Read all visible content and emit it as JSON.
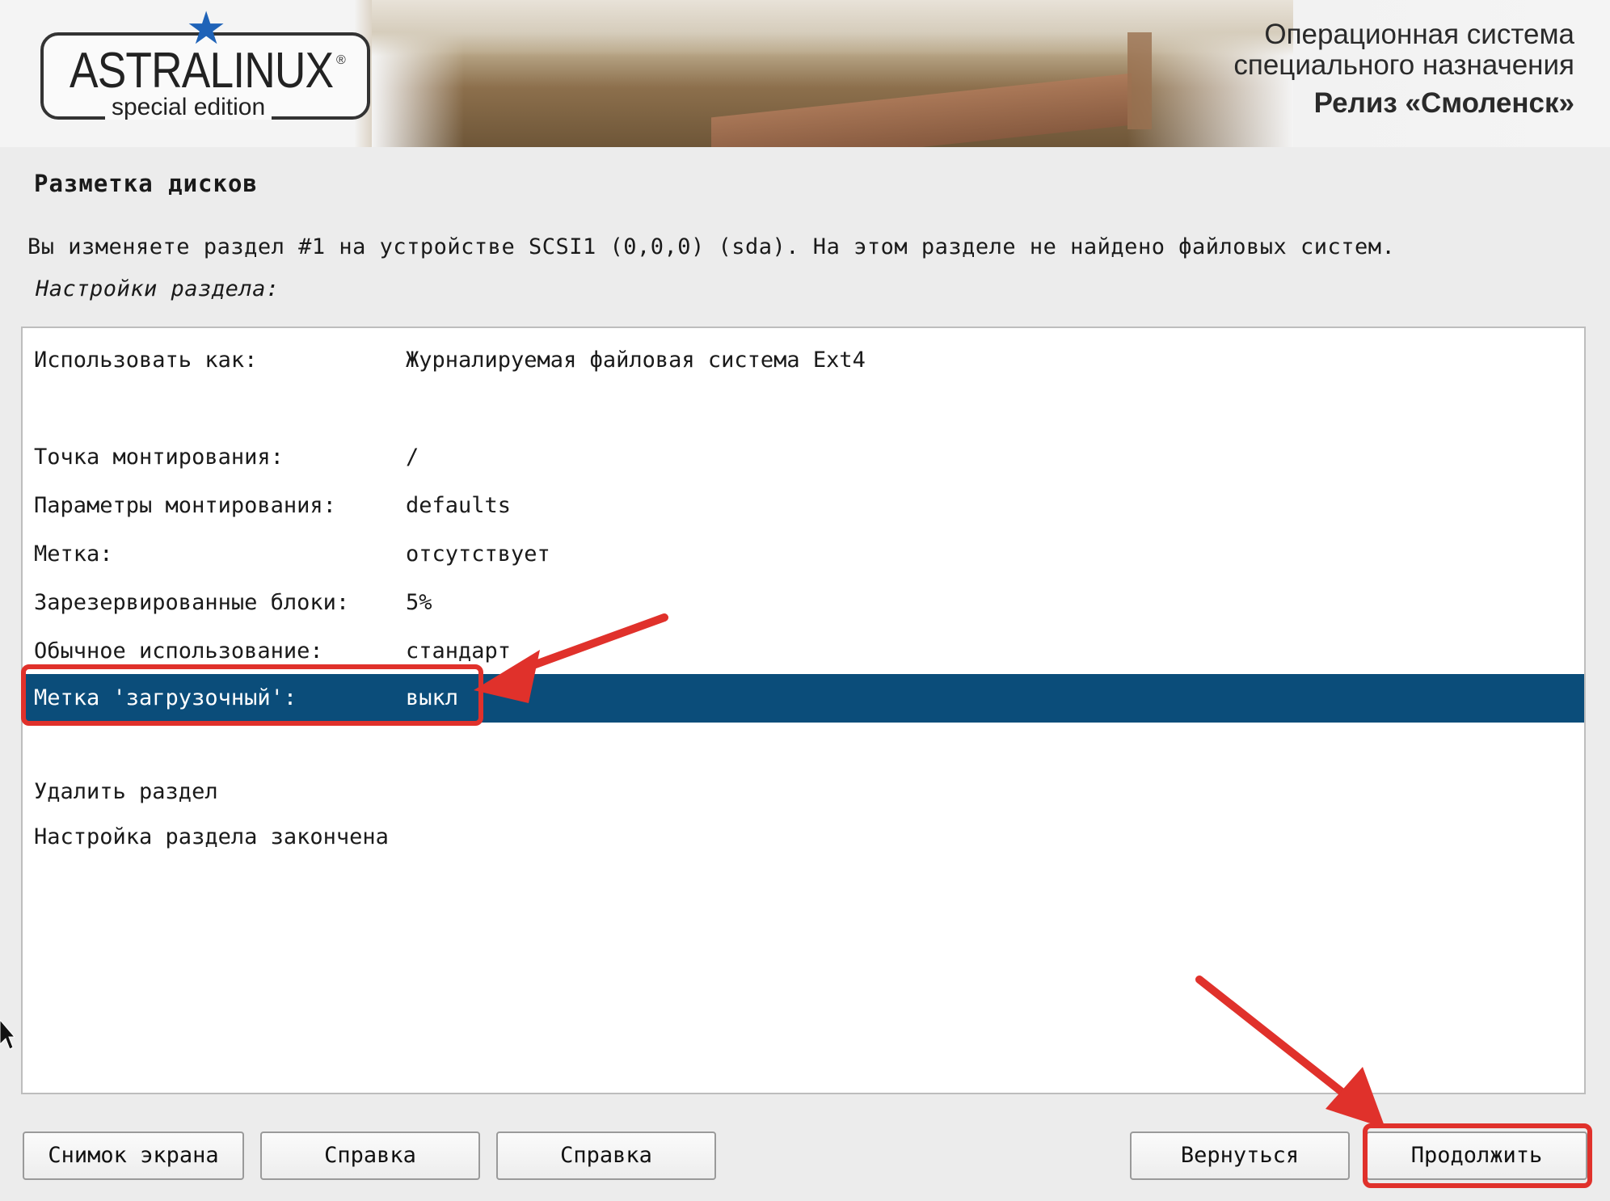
{
  "banner": {
    "logo_text": "ASTRALINUX",
    "logo_sub": "special edition",
    "logo_reg": "®",
    "os_line1": "Операционная система",
    "os_line2": "специального назначения",
    "os_release": "Релиз «Смоленск»"
  },
  "page": {
    "title": "Разметка дисков",
    "description": "Вы изменяете раздел #1 на устройстве SCSI1 (0,0,0) (sda). На этом разделе не найдено файловых систем.",
    "subheading": "Настройки раздела:"
  },
  "settings": [
    {
      "label": "Использовать как:",
      "value": "Журналируемая файловая система Ext4"
    },
    {
      "label": "Точка монтирования:",
      "value": "/"
    },
    {
      "label": "Параметры монтирования:",
      "value": "defaults"
    },
    {
      "label": "Метка:",
      "value": "отсутствует"
    },
    {
      "label": "Зарезервированные блоки:",
      "value": "5%"
    },
    {
      "label": "Обычное использование:",
      "value": "стандарт"
    },
    {
      "label": "Метка 'загрузочный':",
      "value": "выкл"
    }
  ],
  "actions": [
    {
      "label": "Удалить раздел"
    },
    {
      "label": "Настройка раздела закончена"
    }
  ],
  "buttons": {
    "screenshot": "Снимок экрана",
    "help1": "Справка",
    "help2": "Справка",
    "back": "Вернуться",
    "continue": "Продолжить"
  },
  "colors": {
    "selection": "#0b4d7a",
    "annotation": "#e0312b",
    "logo_star": "#1f63b8"
  },
  "icons": {
    "logo": "star-icon",
    "cursor": "mouse-pointer-icon"
  }
}
